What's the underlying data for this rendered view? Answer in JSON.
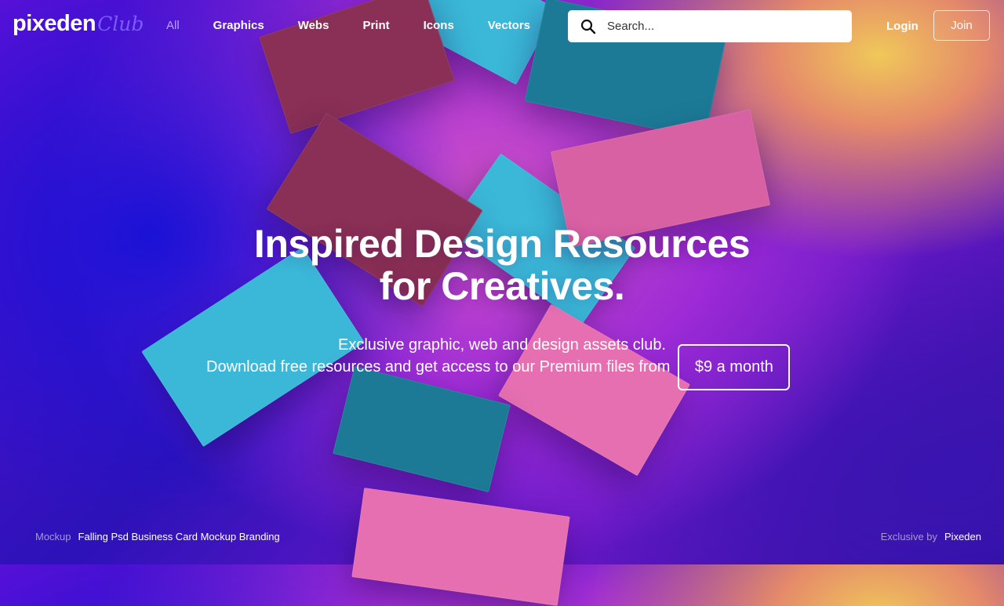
{
  "brand": {
    "name": "pixeden",
    "suffix": "Club",
    "suffix_color": "#7a5cff"
  },
  "nav": {
    "items": [
      {
        "label": "All"
      },
      {
        "label": "Graphics"
      },
      {
        "label": "Webs"
      },
      {
        "label": "Print"
      },
      {
        "label": "Icons"
      },
      {
        "label": "Vectors"
      }
    ]
  },
  "search": {
    "placeholder": "Search...",
    "value": ""
  },
  "auth": {
    "login_label": "Login",
    "join_label": "Join"
  },
  "hero": {
    "title_line1": "Inspired Design Resources",
    "title_line2": "for Creatives.",
    "subtitle_line1": "Exclusive graphic, web and design assets club.",
    "subtitle_line2": "Download free resources and get access to our Premium files from",
    "price_label": "$9 a month"
  },
  "footer": {
    "left_label": "Mockup",
    "left_title": "Falling Psd Business Card Mockup Branding",
    "right_label": "Exclusive by",
    "right_brand": "Pixeden"
  },
  "colors": {
    "cyan": "#3bb7d8",
    "teal": "#1c7a97",
    "maroon": "#8a2f55",
    "pink": "#d861a3"
  },
  "icons": {
    "search": "search-icon"
  }
}
